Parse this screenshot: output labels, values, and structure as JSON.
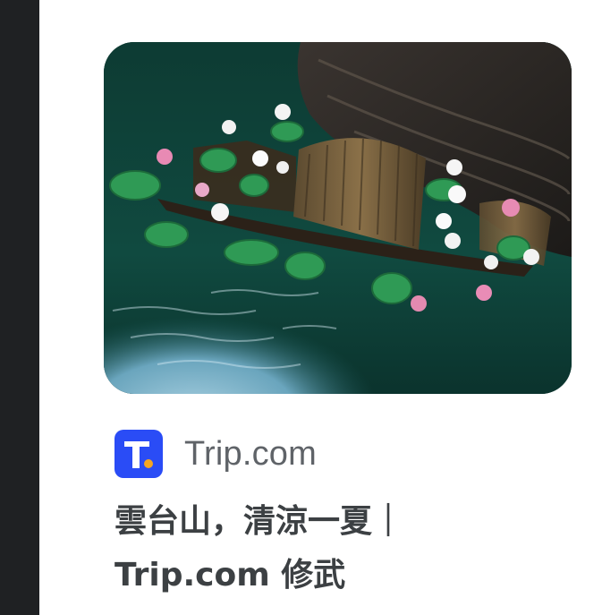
{
  "result": {
    "image_alt": "Boat with lotus flowers on green water",
    "source": {
      "name": "Trip.com",
      "favicon_letter": "T",
      "favicon_color": "#2a4cf6",
      "favicon_dot_color": "#f5a623"
    },
    "title_line1": "雲台山，清涼一夏｜",
    "title_line2": "Trip.com 修武"
  },
  "colors": {
    "rail": "#1f2123",
    "title_text": "#3c4043",
    "source_text": "#5f6368"
  }
}
